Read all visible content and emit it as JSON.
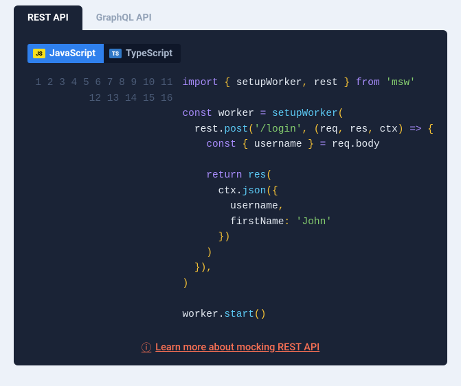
{
  "tabs": {
    "rest": "REST API",
    "graphql": "GraphQL API"
  },
  "langTabs": {
    "js": {
      "badge": "JS",
      "label": "JavaScript"
    },
    "ts": {
      "badge": "TS",
      "label": "TypeScript"
    }
  },
  "code": {
    "lineCount": 16,
    "lines": [
      [
        {
          "t": "import ",
          "c": "tok-kw"
        },
        {
          "t": "{ ",
          "c": "tok-punc"
        },
        {
          "t": "setupWorker",
          "c": "tok-ident"
        },
        {
          "t": ",",
          "c": "tok-punc"
        },
        {
          "t": " rest ",
          "c": "tok-ident"
        },
        {
          "t": "} ",
          "c": "tok-punc"
        },
        {
          "t": "from ",
          "c": "tok-kw"
        },
        {
          "t": "'msw'",
          "c": "tok-str"
        }
      ],
      [],
      [
        {
          "t": "const ",
          "c": "tok-kw"
        },
        {
          "t": "worker ",
          "c": "tok-ident"
        },
        {
          "t": "=",
          "c": "tok-kw"
        },
        {
          "t": " ",
          "c": "tok-ident"
        },
        {
          "t": "setupWorker",
          "c": "tok-fn"
        },
        {
          "t": "(",
          "c": "tok-punc"
        }
      ],
      [
        {
          "t": "  rest",
          "c": "tok-ident"
        },
        {
          "t": ".",
          "c": "tok-dot"
        },
        {
          "t": "post",
          "c": "tok-fn"
        },
        {
          "t": "(",
          "c": "tok-punc"
        },
        {
          "t": "'/login'",
          "c": "tok-str"
        },
        {
          "t": ", (",
          "c": "tok-punc"
        },
        {
          "t": "req",
          "c": "tok-ident"
        },
        {
          "t": ", ",
          "c": "tok-punc"
        },
        {
          "t": "res",
          "c": "tok-ident"
        },
        {
          "t": ", ",
          "c": "tok-punc"
        },
        {
          "t": "ctx",
          "c": "tok-ident"
        },
        {
          "t": ") ",
          "c": "tok-punc"
        },
        {
          "t": "=>",
          "c": "tok-arrow"
        },
        {
          "t": " {",
          "c": "tok-punc"
        }
      ],
      [
        {
          "t": "    ",
          "c": "tok-ident"
        },
        {
          "t": "const ",
          "c": "tok-kw"
        },
        {
          "t": "{ ",
          "c": "tok-punc"
        },
        {
          "t": "username",
          "c": "tok-ident"
        },
        {
          "t": " } ",
          "c": "tok-punc"
        },
        {
          "t": "=",
          "c": "tok-kw"
        },
        {
          "t": " req",
          "c": "tok-ident"
        },
        {
          "t": ".",
          "c": "tok-dot"
        },
        {
          "t": "body",
          "c": "tok-ident"
        }
      ],
      [],
      [
        {
          "t": "    ",
          "c": "tok-ident"
        },
        {
          "t": "return ",
          "c": "tok-kw"
        },
        {
          "t": "res",
          "c": "tok-fn"
        },
        {
          "t": "(",
          "c": "tok-punc"
        }
      ],
      [
        {
          "t": "      ctx",
          "c": "tok-ident"
        },
        {
          "t": ".",
          "c": "tok-dot"
        },
        {
          "t": "json",
          "c": "tok-fn"
        },
        {
          "t": "({",
          "c": "tok-punc"
        }
      ],
      [
        {
          "t": "        username",
          "c": "tok-ident"
        },
        {
          "t": ",",
          "c": "tok-punc"
        }
      ],
      [
        {
          "t": "        firstName",
          "c": "tok-ident"
        },
        {
          "t": ":",
          "c": "tok-punc"
        },
        {
          "t": " ",
          "c": "tok-ident"
        },
        {
          "t": "'John'",
          "c": "tok-str"
        }
      ],
      [
        {
          "t": "      })",
          "c": "tok-punc"
        }
      ],
      [
        {
          "t": "    )",
          "c": "tok-punc"
        }
      ],
      [
        {
          "t": "  }),",
          "c": "tok-punc"
        }
      ],
      [
        {
          "t": ")",
          "c": "tok-punc"
        }
      ],
      [],
      [
        {
          "t": "worker",
          "c": "tok-ident"
        },
        {
          "t": ".",
          "c": "tok-dot"
        },
        {
          "t": "start",
          "c": "tok-fn"
        },
        {
          "t": "()",
          "c": "tok-punc"
        }
      ]
    ]
  },
  "learnMore": {
    "icon": "ⓘ",
    "text": "Learn more about mocking REST API"
  }
}
